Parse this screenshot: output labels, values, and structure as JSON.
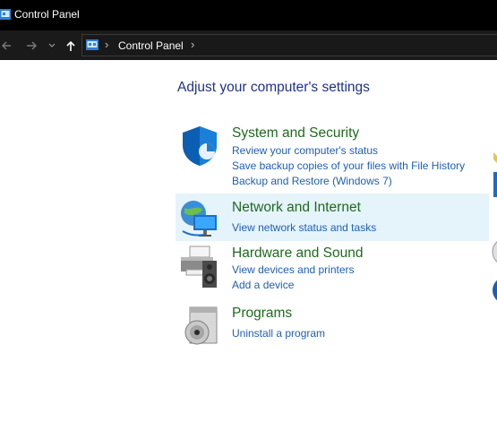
{
  "window": {
    "title": "Control Panel"
  },
  "nav": {
    "back_icon": "back-arrow-icon",
    "forward_icon": "forward-arrow-icon",
    "recent_icon": "chevron-down-icon",
    "up_icon": "up-arrow-icon",
    "address": {
      "icon": "control-panel-icon",
      "path": "Control Panel"
    }
  },
  "main": {
    "heading": "Adjust your computer's settings",
    "categories": [
      {
        "title": "System and Security",
        "icon": "shield-icon",
        "links": [
          "Review your computer's status",
          "Save backup copies of your files with File History",
          "Backup and Restore (Windows 7)"
        ]
      },
      {
        "title": "Network and Internet",
        "icon": "network-globe-icon",
        "links": [
          "View network status and tasks"
        ]
      },
      {
        "title": "Hardware and Sound",
        "icon": "printer-speaker-icon",
        "links": [
          "View devices and printers",
          "Add a device"
        ]
      },
      {
        "title": "Programs",
        "icon": "programs-disc-icon",
        "links": [
          "Uninstall a program"
        ]
      }
    ]
  },
  "colors": {
    "titlebar_bg": "#000000",
    "navbar_bg": "#1a1a1a",
    "heading": "#1e3287",
    "category_title": "#1e6a1e",
    "link": "#1f5fb0",
    "hover_bg": "#e5f3fb"
  }
}
